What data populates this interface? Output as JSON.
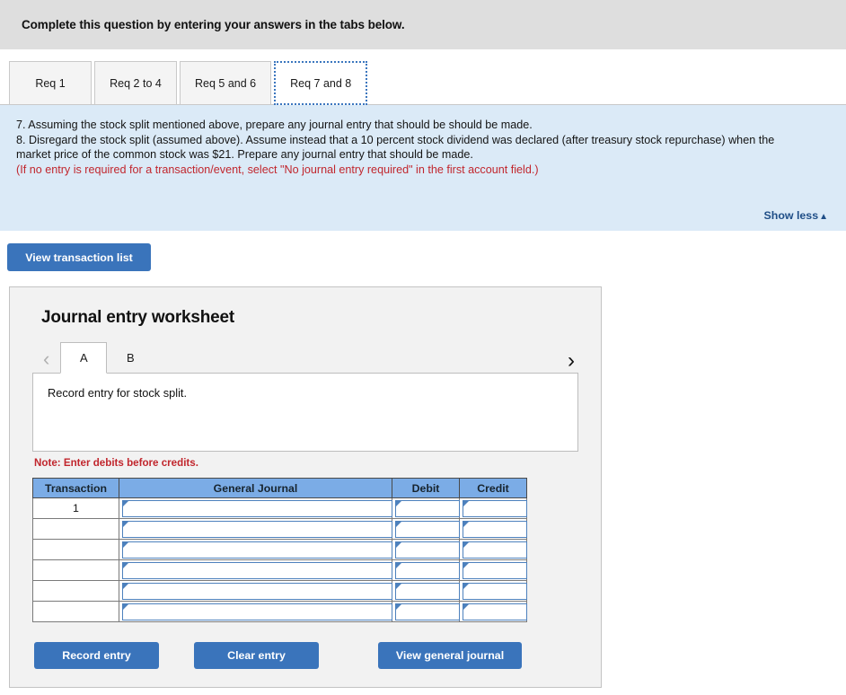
{
  "header": {
    "instruction": "Complete this question by entering your answers in the tabs below."
  },
  "req_tabs": [
    {
      "label": "Req 1",
      "active": false
    },
    {
      "label": "Req 2 to 4",
      "active": false
    },
    {
      "label": "Req 5 and 6",
      "active": false
    },
    {
      "label": "Req 7 and 8",
      "active": true
    }
  ],
  "question": {
    "line7": "7. Assuming the stock split mentioned above, prepare any journal entry that should be should be made.",
    "line8": "8. Disregard the stock split (assumed above). Assume instead that a 10 percent stock dividend was declared (after treasury stock repurchase) when the market price of the common stock was $21. Prepare any journal entry that should be made.",
    "note": "(If no entry is required for a transaction/event, select \"No journal entry required\" in the first account field.)",
    "show_less_label": "Show less",
    "show_less_caret": "▲"
  },
  "toolbar": {
    "view_transaction_list_label": "View transaction list"
  },
  "worksheet": {
    "title": "Journal entry worksheet",
    "prev_arrow": "‹",
    "next_arrow": "›",
    "entry_tabs": [
      {
        "label": "A",
        "active": true
      },
      {
        "label": "B",
        "active": false
      }
    ],
    "description": "Record entry for stock split.",
    "note": "Note: Enter debits before credits.",
    "table": {
      "columns": [
        "Transaction",
        "General Journal",
        "Debit",
        "Credit"
      ],
      "rows": [
        {
          "transaction": "1",
          "general_journal": "",
          "debit": "",
          "credit": ""
        },
        {
          "transaction": "",
          "general_journal": "",
          "debit": "",
          "credit": ""
        },
        {
          "transaction": "",
          "general_journal": "",
          "debit": "",
          "credit": ""
        },
        {
          "transaction": "",
          "general_journal": "",
          "debit": "",
          "credit": ""
        },
        {
          "transaction": "",
          "general_journal": "",
          "debit": "",
          "credit": ""
        },
        {
          "transaction": "",
          "general_journal": "",
          "debit": "",
          "credit": ""
        }
      ]
    },
    "actions": {
      "record_entry_label": "Record entry",
      "clear_entry_label": "Clear entry",
      "view_general_journal_label": "View general journal"
    }
  },
  "colors": {
    "accent_blue": "#3a74bb",
    "table_header_blue": "#7bace6",
    "panel_blue": "#dbeaf7",
    "alert_red": "#c1262d",
    "link_blue": "#1f4e87"
  }
}
